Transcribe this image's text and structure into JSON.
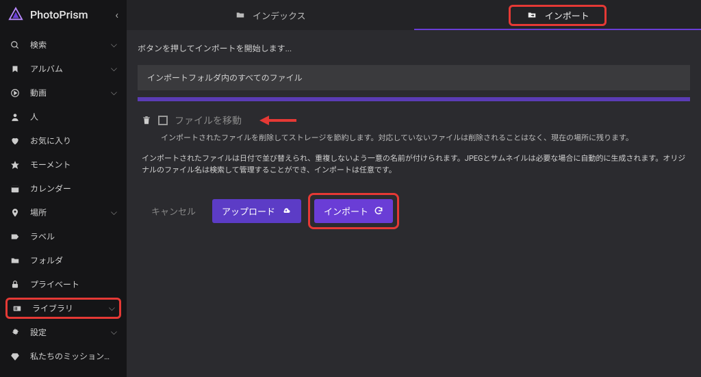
{
  "app": {
    "title": "PhotoPrism"
  },
  "sidebar": {
    "items": [
      {
        "label": "検索",
        "expand": true
      },
      {
        "label": "アルバム",
        "expand": true
      },
      {
        "label": "動画",
        "expand": true
      },
      {
        "label": "人",
        "expand": false
      },
      {
        "label": "お気に入り",
        "expand": false
      },
      {
        "label": "モーメント",
        "expand": false
      },
      {
        "label": "カレンダー",
        "expand": false
      },
      {
        "label": "場所",
        "expand": true
      },
      {
        "label": "ラベル",
        "expand": false
      },
      {
        "label": "フォルダ",
        "expand": false
      },
      {
        "label": "プライベート",
        "expand": false
      },
      {
        "label": "ライブラリ",
        "expand": true
      },
      {
        "label": "設定",
        "expand": true
      },
      {
        "label": "私たちのミッションを支援...",
        "expand": false
      }
    ]
  },
  "tabs": {
    "index": "インデックス",
    "import": "インポート"
  },
  "content": {
    "status": "ボタンを押してインポートを開始します...",
    "folder_label": "インポートフォルダ内のすべてのファイル",
    "move_files": "ファイルを移動",
    "move_desc": "インポートされたファイルを削除してストレージを節約します。対応していないファイルは削除されることはなく、現在の場所に残ります。",
    "info": "インポートされたファイルは日付で並び替えられ、重複しないよう一意の名前が付けられます。JPEGとサムネイルは必要な場合に自動的に生成されます。オリジナルのファイル名は検索して管理することができ、インポートは任意です。",
    "cancel": "キャンセル",
    "upload": "アップロード",
    "import": "インポート"
  }
}
